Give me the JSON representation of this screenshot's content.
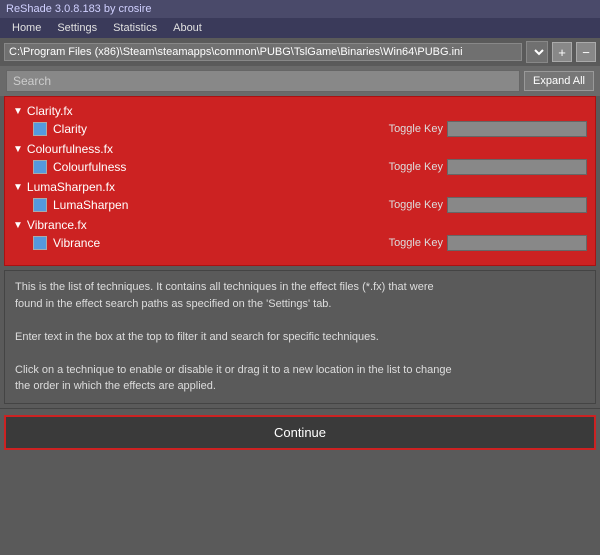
{
  "titleBar": {
    "title": "ReShade 3.0.8.183 by crosire"
  },
  "menuBar": {
    "items": [
      "Home",
      "Settings",
      "Statistics",
      "About"
    ]
  },
  "pathBar": {
    "path": "C:\\Program Files (x86)\\Steam\\steamapps\\common\\PUBG\\TslGame\\Binaries\\Win64\\PUBG.ini",
    "addBtn": "+",
    "removeBtn": "−"
  },
  "searchBar": {
    "placeholder": "Search",
    "expandAllLabel": "Expand All"
  },
  "effects": [
    {
      "groupLabel": "Clarity.fx",
      "items": [
        {
          "name": "Clarity",
          "colorBox": "#5599dd",
          "toggleKeyLabel": "Toggle Key"
        }
      ]
    },
    {
      "groupLabel": "Colourfulness.fx",
      "items": [
        {
          "name": "Colourfulness",
          "colorBox": "#5599dd",
          "toggleKeyLabel": "Toggle Key"
        }
      ]
    },
    {
      "groupLabel": "LumaSharpen.fx",
      "items": [
        {
          "name": "LumaSharpen",
          "colorBox": "#5599dd",
          "toggleKeyLabel": "Toggle Key"
        }
      ]
    },
    {
      "groupLabel": "Vibrance.fx",
      "items": [
        {
          "name": "Vibrance",
          "colorBox": "#5599dd",
          "toggleKeyLabel": "Toggle Key"
        }
      ]
    }
  ],
  "infoText": {
    "line1": "This is the list of techniques. It contains all techniques in the effect files (*.fx) that were",
    "line2": "found in the effect search paths as specified on the 'Settings' tab.",
    "line3": "",
    "line4": "Enter text in the box at the top to filter it and search for specific techniques.",
    "line5": "",
    "line6": "Click on a technique to enable or disable it or drag it to a new location in the list to change",
    "line7": "the order in which the effects are applied."
  },
  "continueBtn": {
    "label": "Continue"
  }
}
